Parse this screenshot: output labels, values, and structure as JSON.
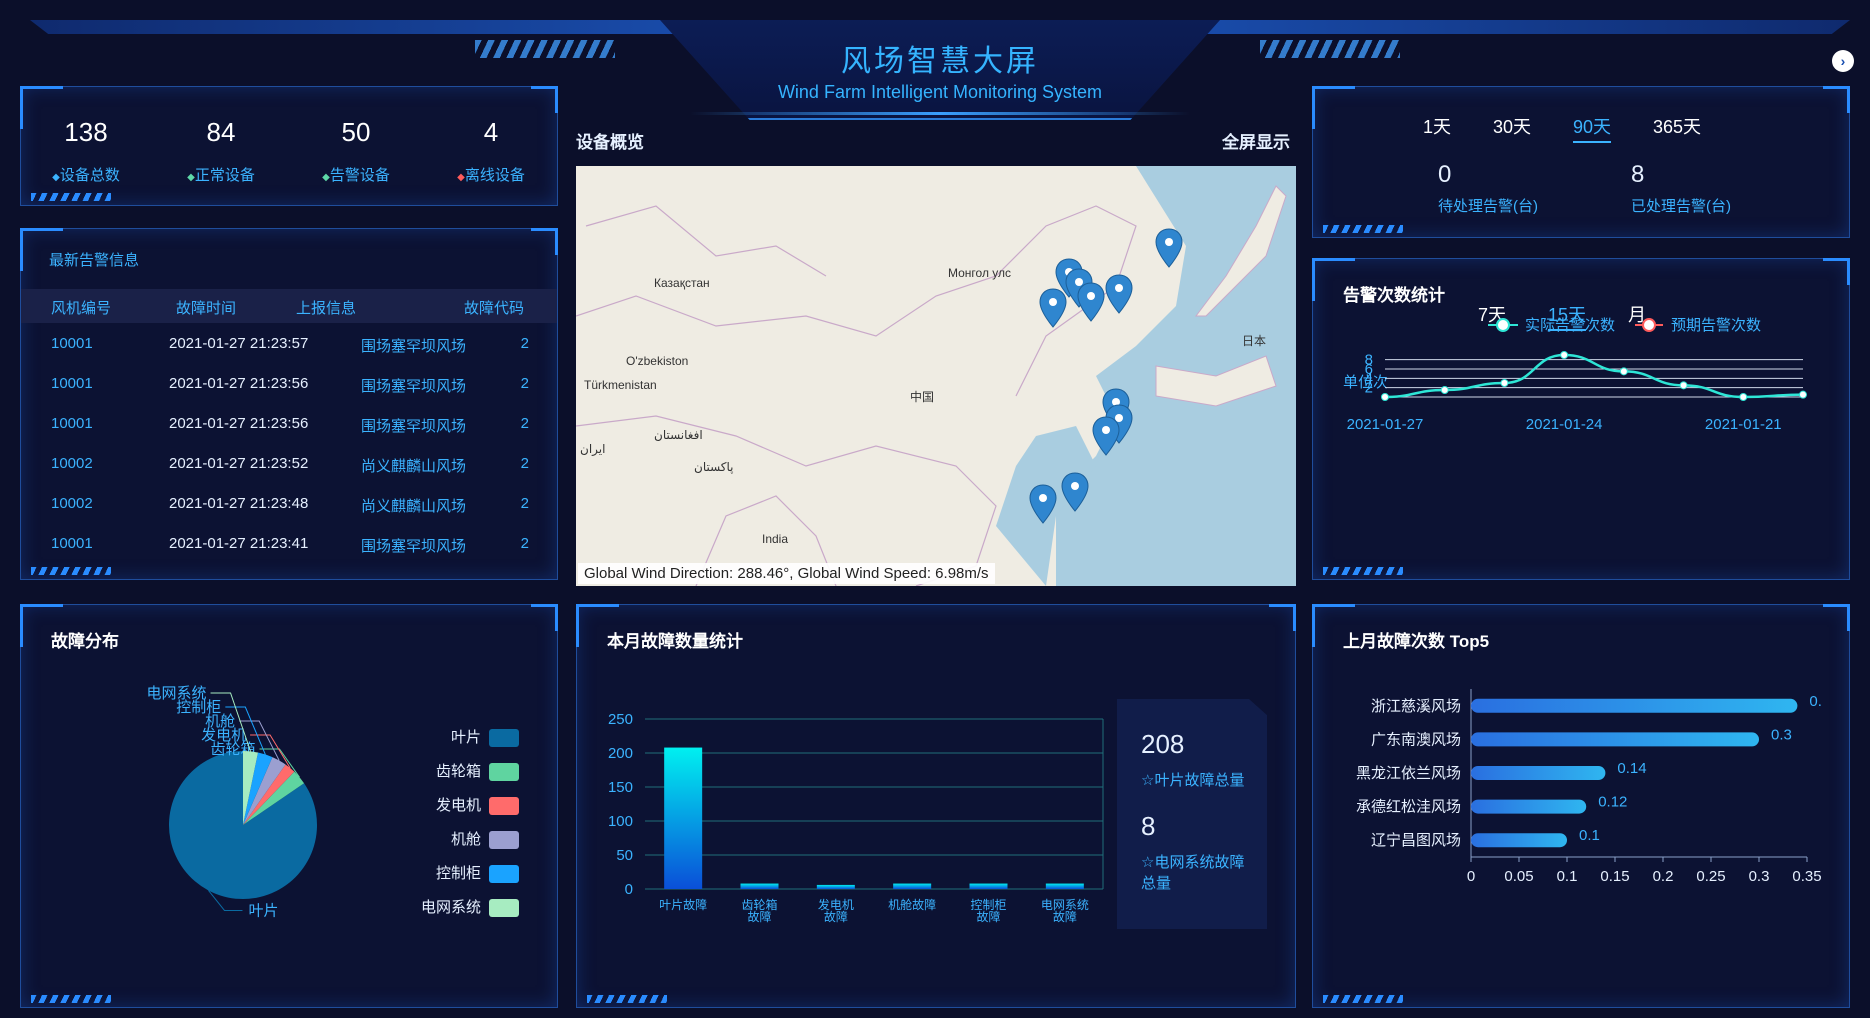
{
  "header": {
    "title": "风场智慧大屏",
    "subtitle": "Wind Farm Intelligent Monitoring System"
  },
  "stats": [
    {
      "value": "138",
      "label": "设备总数",
      "color": "#3bb3ff"
    },
    {
      "value": "84",
      "label": "正常设备",
      "color": "#5ed8a8"
    },
    {
      "value": "50",
      "label": "告警设备",
      "color": "#5ed8a8"
    },
    {
      "value": "4",
      "label": "离线设备",
      "color": "#ff5b5b"
    }
  ],
  "alarms": {
    "title": "最新告警信息",
    "headers": [
      "风机编号",
      "故障时间",
      "上报信息",
      "故障代码"
    ],
    "rows": [
      [
        "10001",
        "2021-01-27 21:23:57",
        "围场塞罕坝风场",
        "2"
      ],
      [
        "10001",
        "2021-01-27 21:23:56",
        "围场塞罕坝风场",
        "2"
      ],
      [
        "10001",
        "2021-01-27 21:23:56",
        "围场塞罕坝风场",
        "2"
      ],
      [
        "10002",
        "2021-01-27 21:23:52",
        "尚义麒麟山风场",
        "2"
      ],
      [
        "10002",
        "2021-01-27 21:23:48",
        "尚义麒麟山风场",
        "2"
      ],
      [
        "10001",
        "2021-01-27 21:23:41",
        "围场塞罕坝风场",
        "2"
      ]
    ]
  },
  "map": {
    "title": "设备概览",
    "fullscreen": "全屏显示",
    "labels": [
      "Казақстан",
      "Монгол улс",
      "O'zbekiston",
      "Türkmenistan",
      "中国",
      "日本",
      "افغانستان",
      "ایران",
      "پاکستان",
      "India"
    ],
    "status": "Global Wind Direction: 288.46°, Global Wind Speed: 6.98m/s"
  },
  "period": {
    "tabs": [
      "1天",
      "30天",
      "90天",
      "365天"
    ],
    "active": "90天",
    "pending_value": "0",
    "pending_label": "待处理告警(台)",
    "handled_value": "8",
    "handled_label": "已处理告警(台)"
  },
  "alarm_count": {
    "title": "告警次数统计",
    "tabs": [
      "7天",
      "15天",
      "月"
    ],
    "active": "15天",
    "unit": "单位次"
  },
  "fault_dist": {
    "title": "故障分布"
  },
  "month_fault": {
    "title": "本月故障数量统计",
    "summary1_value": "208",
    "summary1_label": "☆叶片故障总量",
    "summary2_value": "8",
    "summary2_label": "☆电网系统故障总量"
  },
  "top5": {
    "title": "上月故障次数 Top5"
  },
  "chart_data": [
    {
      "type": "line",
      "title": "告警次数统计",
      "ylabel": "单位次",
      "x_ticks": [
        "2021-01-27",
        "2021-01-24",
        "2021-01-21"
      ],
      "ylim": [
        0,
        9
      ],
      "y_ticks": [
        2,
        4,
        6,
        8
      ],
      "series": [
        {
          "name": "实际告警次数",
          "color": "#2ee6d6",
          "values": [
            0,
            1.5,
            3,
            9,
            5.5,
            2.5,
            0,
            0.5
          ]
        },
        {
          "name": "预期告警次数",
          "color": "#ff5b5b",
          "values": []
        }
      ]
    },
    {
      "type": "pie",
      "title": "故障分布",
      "categories": [
        "叶片",
        "齿轮箱",
        "发电机",
        "机舱",
        "控制柜",
        "电网系统"
      ],
      "values": [
        208,
        8,
        6,
        8,
        8,
        8
      ],
      "colors": [
        "#0a6aa1",
        "#5fd4a0",
        "#ff6b6b",
        "#9b9fd0",
        "#1aa3ff",
        "#a7ecc1"
      ]
    },
    {
      "type": "bar",
      "title": "本月故障数量统计",
      "categories": [
        "叶片故障",
        "齿轮箱故障",
        "发电机故障",
        "机舱故障",
        "控制柜故障",
        "电网系统故障"
      ],
      "values": [
        208,
        8,
        6,
        8,
        8,
        8
      ],
      "ylim": [
        0,
        250
      ],
      "y_ticks": [
        0,
        50,
        100,
        150,
        200,
        250
      ]
    },
    {
      "type": "bar",
      "orientation": "horizontal",
      "title": "上月故障次数 Top5",
      "categories": [
        "浙江慈溪风场",
        "广东南澳风场",
        "黑龙江依兰风场",
        "承德红松洼风场",
        "辽宁昌图风场"
      ],
      "values": [
        0.34,
        0.3,
        0.14,
        0.12,
        0.1
      ],
      "value_labels": [
        "0.",
        "0.3",
        "0.14",
        "0.12",
        "0.1"
      ],
      "xlim": [
        0,
        0.35
      ],
      "x_ticks": [
        0,
        0.05,
        0.1,
        0.15,
        0.2,
        0.25,
        0.3,
        0.35
      ]
    }
  ]
}
